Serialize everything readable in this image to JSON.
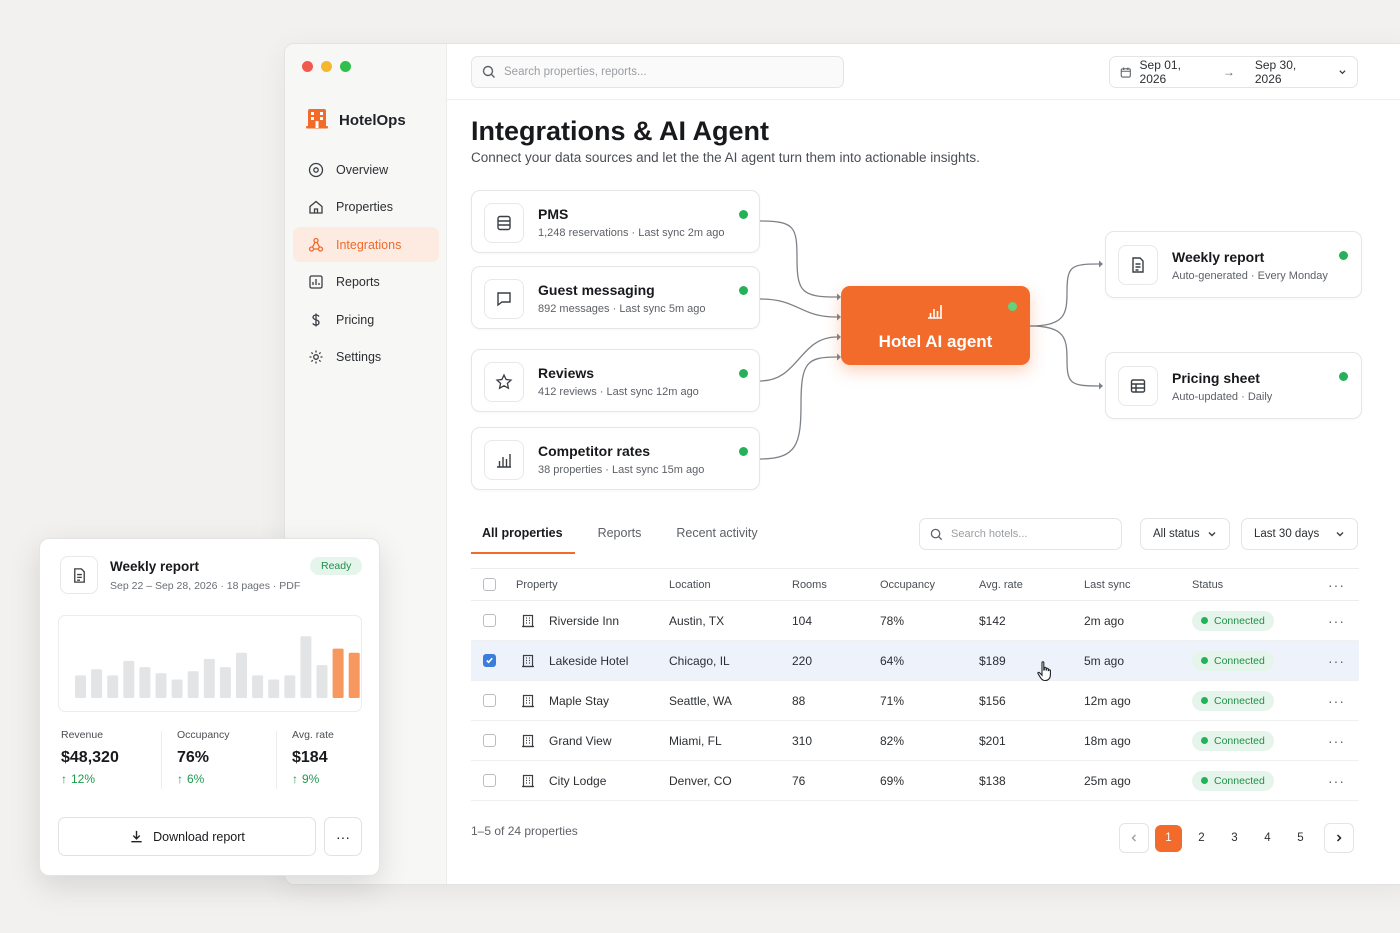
{
  "app": {
    "name": "HotelOps"
  },
  "colors": {
    "accent": "#f26b2a",
    "success": "#27b05a",
    "selected_row": "#eef3fb"
  },
  "sidebar": {
    "items": [
      {
        "label": "Overview",
        "icon": "compass-icon"
      },
      {
        "label": "Properties",
        "icon": "home-icon"
      },
      {
        "label": "Integrations",
        "icon": "integrations-icon",
        "active": true
      },
      {
        "label": "Reports",
        "icon": "report-icon"
      },
      {
        "label": "Pricing",
        "icon": "dollar-icon"
      },
      {
        "label": "Settings",
        "icon": "gear-icon"
      }
    ]
  },
  "topbar": {
    "search_placeholder": "Search properties, reports...",
    "date_from": "Sep 01, 2026",
    "date_to": "Sep 30, 2026"
  },
  "page": {
    "title": "Integrations & AI Agent",
    "subtitle": "Connect your data sources and let the the AI agent turn them into actionable insights."
  },
  "sources": [
    {
      "name": "PMS",
      "meta": "1,248 reservations · Last sync 2m ago",
      "icon": "database-icon"
    },
    {
      "name": "Guest messaging",
      "meta": "892 messages · Last sync 5m ago",
      "icon": "chat-icon"
    },
    {
      "name": "Reviews",
      "meta": "412 reviews · Last sync 12m ago",
      "icon": "star-icon"
    },
    {
      "name": "Competitor rates",
      "meta": "38 properties · Last sync 15m ago",
      "icon": "bar-chart-icon"
    }
  ],
  "agent": {
    "label": "Hotel AI agent"
  },
  "outputs": [
    {
      "name": "Weekly report",
      "meta": "Auto-generated · Every Monday",
      "icon": "document-icon"
    },
    {
      "name": "Pricing sheet",
      "meta": "Auto-updated · Daily",
      "icon": "table-icon"
    }
  ],
  "tabs": [
    "All properties",
    "Reports",
    "Recent activity"
  ],
  "table_controls": {
    "search_placeholder": "Search hotels...",
    "status_filter": "All status",
    "range_filter": "Last 30 days"
  },
  "table": {
    "columns": [
      "Property",
      "Location",
      "Rooms",
      "Occupancy",
      "Avg. rate",
      "Last sync",
      "Status"
    ],
    "rows": [
      {
        "property": "Riverside Inn",
        "location": "Austin, TX",
        "rooms": "104",
        "occupancy": "78%",
        "rate": "$142",
        "sync": "2m ago",
        "status": "Connected",
        "checked": false
      },
      {
        "property": "Lakeside Hotel",
        "location": "Chicago, IL",
        "rooms": "220",
        "occupancy": "64%",
        "rate": "$189",
        "sync": "5m ago",
        "status": "Connected",
        "checked": true
      },
      {
        "property": "Maple Stay",
        "location": "Seattle, WA",
        "rooms": "88",
        "occupancy": "71%",
        "rate": "$156",
        "sync": "12m ago",
        "status": "Connected",
        "checked": false
      },
      {
        "property": "Grand View",
        "location": "Miami, FL",
        "rooms": "310",
        "occupancy": "82%",
        "rate": "$201",
        "sync": "18m ago",
        "status": "Connected",
        "checked": false
      },
      {
        "property": "City Lodge",
        "location": "Denver, CO",
        "rooms": "76",
        "occupancy": "69%",
        "rate": "$138",
        "sync": "25m ago",
        "status": "Connected",
        "checked": false
      }
    ]
  },
  "footer": {
    "count": "1–5 of 24 properties",
    "pages": [
      "1",
      "2",
      "3",
      "4",
      "5"
    ],
    "current_page": "1"
  },
  "report_card": {
    "title": "Weekly report",
    "meta": "Sep 22 – Sep 28, 2026 · 18 pages · PDF",
    "badge": "Ready",
    "bars": [
      22,
      28,
      22,
      36,
      30,
      24,
      18,
      26,
      38,
      30,
      44,
      22,
      18,
      22,
      60,
      32,
      48,
      44,
      68
    ],
    "highlight_from": 16,
    "stats": [
      {
        "label": "Revenue",
        "value": "$48,320",
        "change": "12%"
      },
      {
        "label": "Occupancy",
        "value": "76%",
        "change": "6%"
      },
      {
        "label": "Avg. rate",
        "value": "$184",
        "change": "9%"
      }
    ],
    "download_label": "Download report"
  }
}
